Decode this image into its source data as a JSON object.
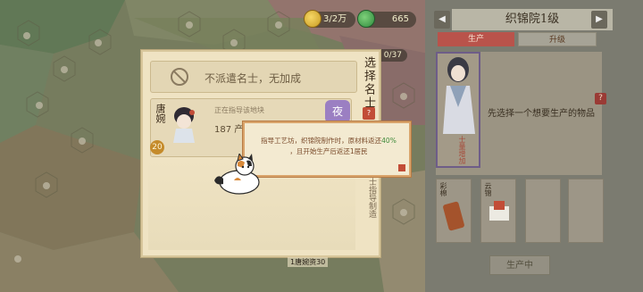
{
  "resources": {
    "coin": "3/2万",
    "jade": "665",
    "count": "0/37"
  },
  "workshop": {
    "title": "织锦院1级",
    "prev_label": "◀",
    "next_label": "▶",
    "tabs": [
      "生产",
      "升级"
    ],
    "portrait_tag": "士量增加",
    "hint": "先选择一个想要生产的物品",
    "help_label": "?",
    "items": [
      "彩棉",
      "云锦",
      "",
      ""
    ],
    "produce_button": "生产中"
  },
  "dialog": {
    "title": "选择名士",
    "close_label": "?",
    "no_dispatch": "不派遣名士，无加成",
    "scholar": {
      "name": "唐婉",
      "level": "20",
      "status": "正在指导该地块",
      "value": "187 产",
      "badge": "夜"
    },
    "subtitle": "名士指导制造"
  },
  "tooltip": {
    "line1_prefix": "指导工艺坊，织锦院制作时，原材料返还",
    "line1_highlight": "40%",
    "line2": "，且开始生产后返还1居民"
  },
  "caption": "1唐婉资30",
  "colors": {
    "accent_red": "#b9534b",
    "badge_purple": "#9b7fc2",
    "highlight_green": "#3f8a3a",
    "level_gold": "#c58b2b"
  }
}
